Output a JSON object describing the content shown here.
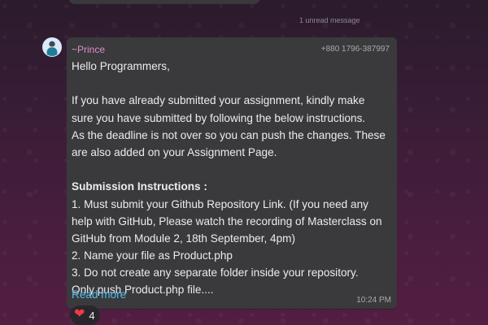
{
  "unread": {
    "label": "1 unread message"
  },
  "message": {
    "sender": "~Prince",
    "phone": "+880 1796-387997",
    "time": "10:24 PM",
    "read_more": "Read more",
    "lines": [
      "Hello Programmers,",
      "If you have already submitted your assignment, kindly make",
      "sure you have submitted by following the below instructions.",
      "As the deadline is not over so you can push the changes. These",
      "are also added on your Assignment Page.",
      "Submission Instructions :",
      "1. Must submit your Github Repository Link. (If you need any",
      "help with GitHub, Please watch the recording of Masterclass on",
      "GitHub from Module 2, 18th September, 4pm)",
      "2. Name your file as Product.php",
      "3. Do not create any separate folder inside your repository.",
      "Only push Product.php file...."
    ]
  },
  "reaction": {
    "icon": "heart-icon",
    "count": "4"
  },
  "colors": {
    "bubble": "#3a3a3d",
    "sender": "#df8ec7",
    "link": "#53bdeb",
    "heart": "#ef3b45"
  }
}
